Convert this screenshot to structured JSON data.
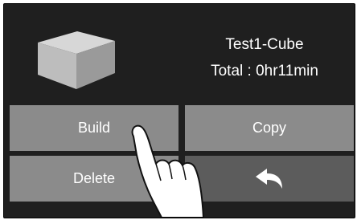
{
  "file": {
    "name": "Test1-Cube",
    "total_time": "Total : 0hr11min"
  },
  "buttons": {
    "build": "Build",
    "copy": "Copy",
    "delete": "Delete"
  },
  "icons": {
    "model_preview": "cube-icon",
    "back": "back-arrow-icon",
    "hand": "pointing-hand-icon"
  },
  "colors": {
    "screen_bg": "#1f1f1f",
    "button_light": "#8b8b8b",
    "button_dark": "#5c5c5c",
    "text": "#ffffff"
  }
}
